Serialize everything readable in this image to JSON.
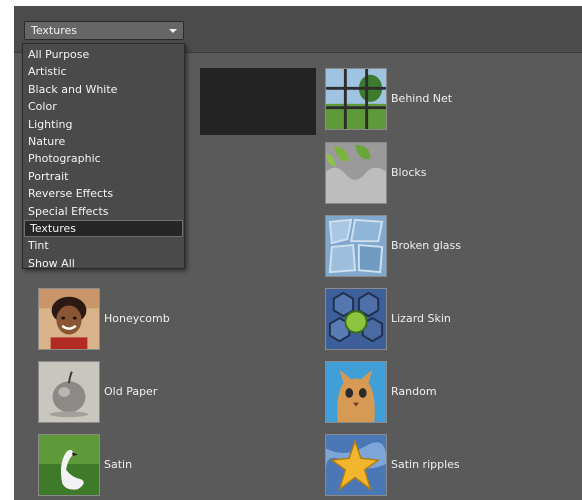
{
  "filter_select": {
    "selected": "Textures",
    "options": [
      "All Purpose",
      "Artistic",
      "Black and White",
      "Color",
      "Lighting",
      "Nature",
      "Photographic",
      "Portrait",
      "Reverse Effects",
      "Special Effects",
      "Textures",
      "Tint",
      "Show All"
    ],
    "highlighted_index": 10
  },
  "effects_left": [
    {
      "label": "Honeycomb",
      "thumb": "girl-portrait"
    },
    {
      "label": "Old Paper",
      "thumb": "apple-sketch"
    },
    {
      "label": "Satin",
      "thumb": "swan"
    }
  ],
  "effects_right": [
    {
      "label": "Behind Net",
      "thumb": "field-grid"
    },
    {
      "label": "Blocks",
      "thumb": "leaves-blocks"
    },
    {
      "label": "Broken glass",
      "thumb": "broken-glass"
    },
    {
      "label": "Lizard Skin",
      "thumb": "lizard-skin"
    },
    {
      "label": "Random",
      "thumb": "cat"
    },
    {
      "label": "Satin ripples",
      "thumb": "starfish"
    }
  ],
  "colors": {
    "panel_bg": "#5a5a5a",
    "menu_bg": "#4a4a4a",
    "menu_selected_bg": "#262626"
  }
}
